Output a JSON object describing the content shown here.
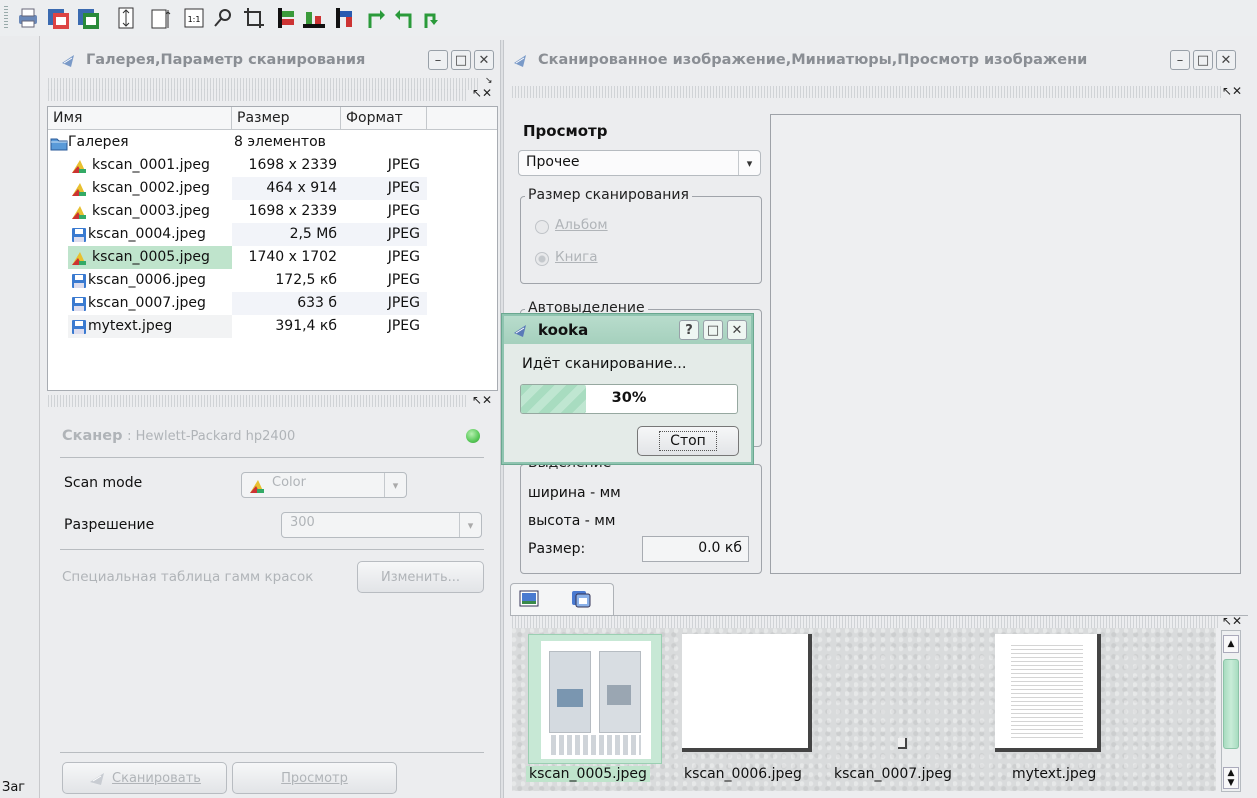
{
  "status": {
    "text": "Заг"
  },
  "gallery_window": {
    "title": "Галерея,Параметр сканирования"
  },
  "table": {
    "headers": [
      "Имя",
      "Размер",
      "Формат"
    ],
    "root": {
      "name": "Галерея",
      "size": "8 элементов"
    },
    "rows": [
      {
        "name": "kscan_0001.jpeg",
        "size": "1698 x 2339",
        "format": "JPEG",
        "icon": "image-file-icon"
      },
      {
        "name": "kscan_0002.jpeg",
        "size": "464 x 914",
        "format": "JPEG",
        "icon": "image-file-icon"
      },
      {
        "name": "kscan_0003.jpeg",
        "size": "1698 x 2339",
        "format": "JPEG",
        "icon": "image-file-icon"
      },
      {
        "name": "kscan_0004.jpeg",
        "size": "2,5 Мб",
        "format": "JPEG",
        "icon": "floppy-file-icon"
      },
      {
        "name": "kscan_0005.jpeg",
        "size": "1740 x 1702",
        "format": "JPEG",
        "icon": "image-file-icon"
      },
      {
        "name": "kscan_0006.jpeg",
        "size": "172,5 кб",
        "format": "JPEG",
        "icon": "floppy-file-icon"
      },
      {
        "name": "kscan_0007.jpeg",
        "size": "633 б",
        "format": "JPEG",
        "icon": "floppy-file-icon"
      },
      {
        "name": "mytext.jpeg",
        "size": "391,4 кб",
        "format": "JPEG",
        "icon": "floppy-file-icon"
      }
    ]
  },
  "scanner": {
    "title": "Сканер",
    "device": ": Hewlett-Packard hp2400",
    "scan_mode_label": "Scan mode",
    "scan_mode_value": "Color",
    "resolution_label": "Разрешение",
    "resolution_value": "300",
    "gamma_label": "Специальная таблица гамм красок",
    "gamma_button": "Изменить...",
    "scan_button": "Сканировать",
    "preview_button": "Просмотр"
  },
  "image_window": {
    "title": "Сканированное изображение,Миниатюры,Просмотр изображени"
  },
  "preview": {
    "heading": "Просмотр",
    "preset": "Прочее",
    "scan_size_group": "Размер сканирования",
    "album": "Альбом",
    "book": "Книга",
    "autoselect_group": "Автовыделение",
    "selection_group": "Выделение",
    "width": "ширина - мм",
    "height": "высота - мм",
    "size_label": "Размер:",
    "size_value": "0.0 кб"
  },
  "dialog": {
    "title": "kooka",
    "message": "Идёт сканирование...",
    "progress_percent": 30,
    "progress_text": "30%",
    "stop_button": "Стоп",
    "help_button": "?"
  },
  "thumbnails": [
    {
      "label": "kscan_0005.jpeg",
      "selected": true
    },
    {
      "label": "kscan_0006.jpeg",
      "selected": false
    },
    {
      "label": "kscan_0007.jpeg",
      "selected": false
    },
    {
      "label": "mytext.jpeg",
      "selected": false
    }
  ],
  "colors": {
    "selection": "#bfe4cc",
    "accent": "#8fc4b0",
    "led": "#58c858"
  }
}
